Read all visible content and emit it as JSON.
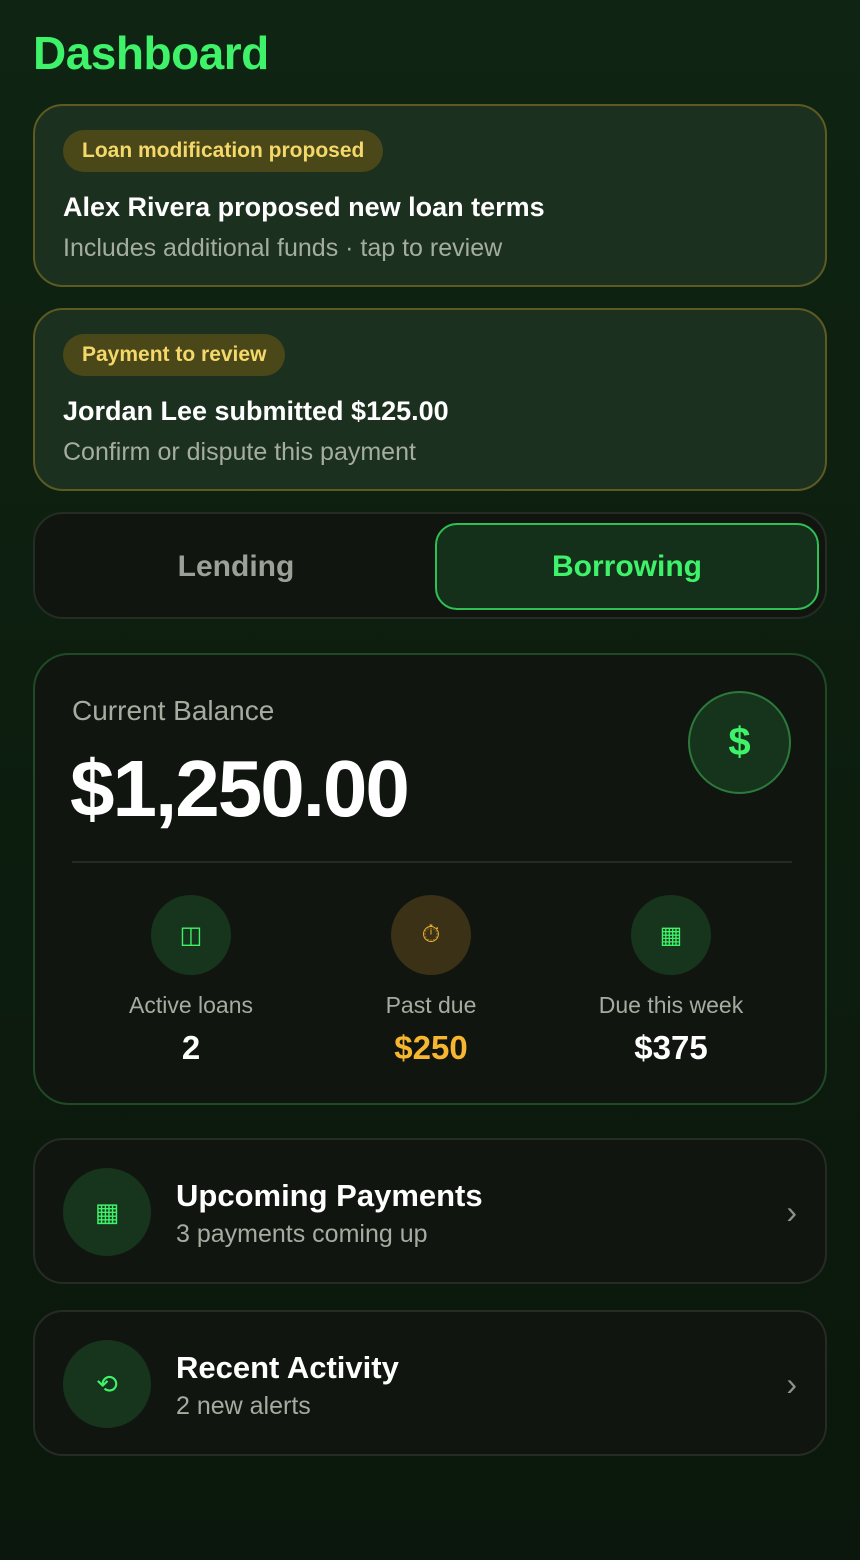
{
  "header": {
    "title": "Dashboard"
  },
  "notices": [
    {
      "badge": "Loan modification proposed",
      "headline": "Alex Rivera proposed new loan terms",
      "subtext": "Includes additional funds · tap to review"
    },
    {
      "badge": "Payment to review",
      "headline": "Jordan Lee submitted $125.00",
      "subtext": "Confirm or dispute this payment"
    }
  ],
  "mode_toggle": {
    "options": [
      "Lending",
      "Borrowing"
    ],
    "selected": "Borrowing"
  },
  "balance": {
    "label": "Current Balance",
    "amount": "$1,250.00",
    "icon": "dollar-icon",
    "icon_glyph": "$",
    "stats": [
      {
        "label": "Active loans",
        "value": "2",
        "icon": "columns-icon",
        "icon_glyph": "◫"
      },
      {
        "label": "Past due",
        "value": "$250",
        "icon": "stopwatch-icon",
        "icon_glyph": "⏱"
      },
      {
        "label": "Due this week",
        "value": "$375",
        "icon": "calendar-icon",
        "icon_glyph": "▦"
      }
    ]
  },
  "sections": [
    {
      "title": "Upcoming Payments",
      "subtitle": "3 payments coming up",
      "icon": "calendar-icon",
      "icon_glyph": "▦"
    },
    {
      "title": "Recent Activity",
      "subtitle": "2 new alerts",
      "icon": "history-icon",
      "icon_glyph": "⟲"
    }
  ],
  "colors": {
    "accent": "#3ef26a",
    "warning": "#f7b62f",
    "badge_text": "#f4d86a"
  }
}
